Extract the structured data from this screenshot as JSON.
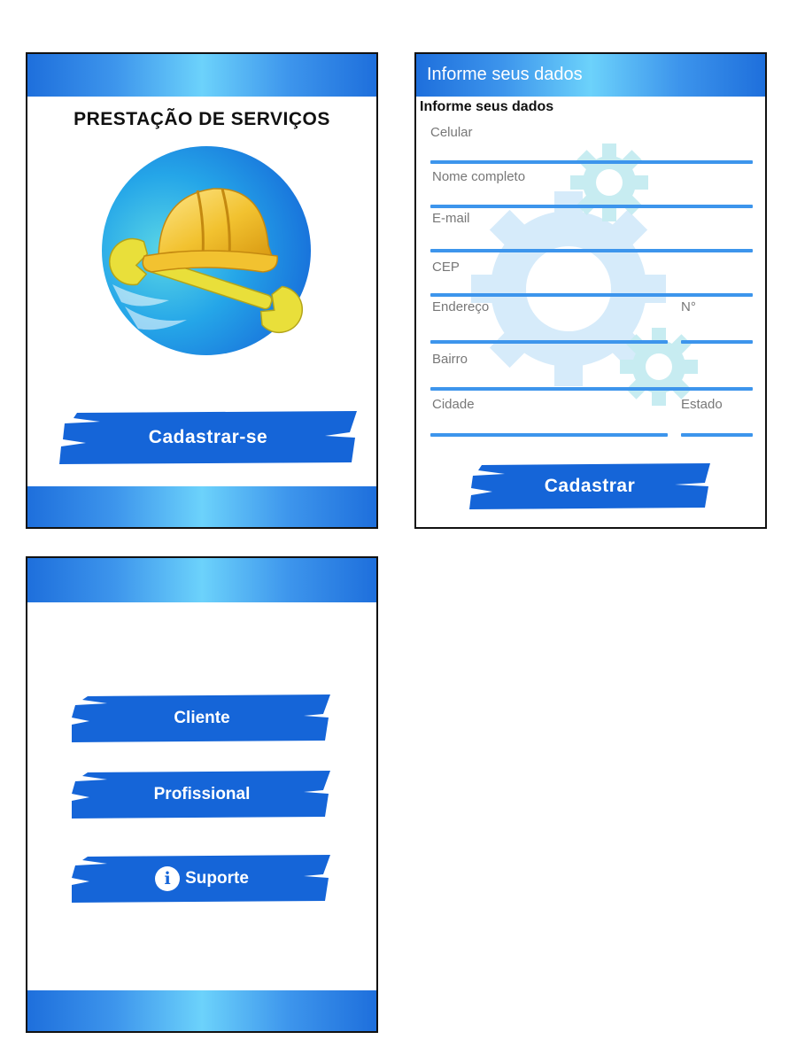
{
  "welcome": {
    "title": "PRESTAÇÃO DE SERVIÇOS",
    "logo_icon": "helmet-wrench-icon",
    "register_button": "Cadastrar-se"
  },
  "register": {
    "header": "Informe seus dados",
    "subtitle": "Informe seus dados",
    "fields": {
      "celular": "Celular",
      "nome": "Nome completo",
      "email": "E-mail",
      "cep": "CEP",
      "endereco": "Endereço",
      "numero": "N°",
      "bairro": "Bairro",
      "cidade": "Cidade",
      "estado": "Estado"
    },
    "background_icon": "gears-icon",
    "submit_button": "Cadastrar"
  },
  "choose": {
    "cliente_button": "Cliente",
    "profissional_button": "Profissional",
    "suporte_button": "Suporte",
    "suporte_icon": "info-icon"
  },
  "colors": {
    "primary_blue": "#1565d8",
    "light_blue": "#6cd2fb",
    "field_line": "#3d95ec",
    "helmet_yellow": "#f2c230"
  }
}
